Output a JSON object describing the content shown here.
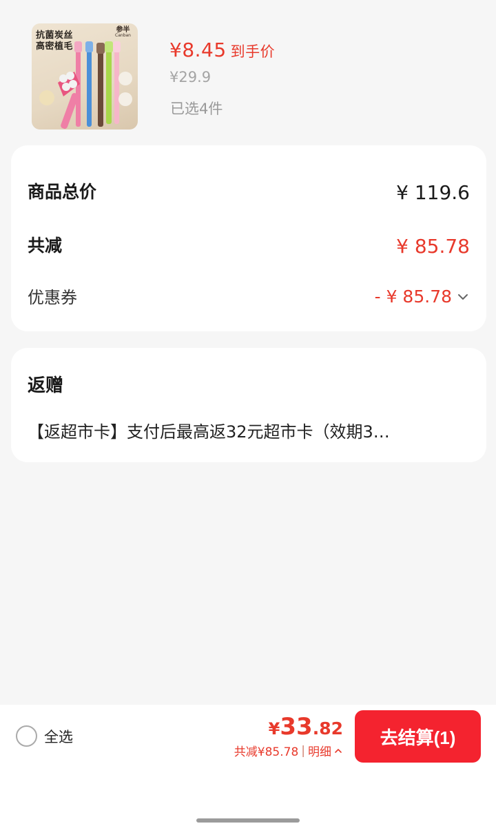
{
  "product": {
    "image": {
      "headline_line1": "抗菌炭丝",
      "headline_line2": "高密植毛",
      "brand": "参半",
      "brand_en": "Canban"
    },
    "price_now": "¥8.45",
    "price_tag": "到手价",
    "price_original": "¥29.9",
    "selected_count": "已选4件"
  },
  "summary": {
    "total_label": "商品总价",
    "total_value": "¥ 119.6",
    "discount_label": "共减",
    "discount_value": "¥ 85.78",
    "coupon_label": "优惠券",
    "coupon_value": "- ¥ 85.78"
  },
  "gift": {
    "title": "返赠",
    "description": "【返超市卡】支付后最高返32元超市卡（效期3…"
  },
  "bottom_bar": {
    "select_all_label": "全选",
    "total_currency": "¥",
    "total_int": "33",
    "total_dec": ".82",
    "detail_saved": "共减¥85.78",
    "detail_sep": "|",
    "detail_label": "明细",
    "checkout_label": "去结算(1)"
  },
  "colors": {
    "accent_red": "#e8392b",
    "button_red": "#f4232f",
    "background": "#f6f6f6"
  }
}
